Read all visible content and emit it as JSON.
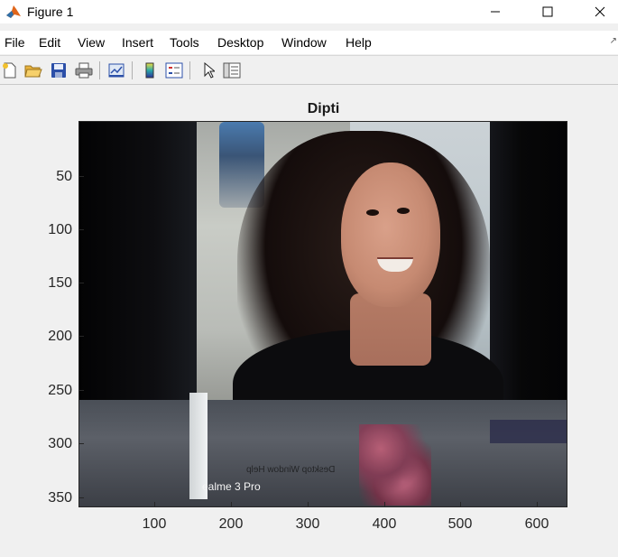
{
  "window": {
    "title": "Figure 1",
    "controls": {
      "minimize": "–",
      "maximize": "☐",
      "close": "✕"
    }
  },
  "menubar": {
    "items": [
      "File",
      "Edit",
      "View",
      "Insert",
      "Tools",
      "Desktop",
      "Window",
      "Help"
    ],
    "overflow_glyph": "↗"
  },
  "toolbar": {
    "buttons": [
      "new-figure-icon",
      "open-file-icon",
      "save-icon",
      "print-icon",
      "link-plot-icon",
      "insert-colorbar-icon",
      "insert-legend-icon",
      "edit-plot-arrow-icon",
      "property-editor-icon"
    ]
  },
  "axes": {
    "title": "Dipti",
    "yticks": [
      "50",
      "100",
      "150",
      "200",
      "250",
      "300",
      "350"
    ],
    "xticks": [
      "100",
      "200",
      "300",
      "400",
      "500",
      "600"
    ]
  },
  "image": {
    "description_text": "",
    "visible_text": {
      "watermark": "ealme 3 Pro",
      "laptop_menu": "Desktop  Window  Help"
    }
  },
  "colors": {
    "window_bg": "#f0f0f0",
    "titlebar_bg": "#ffffff",
    "axes_border": "#262626",
    "matlab_icon_orange": "#e0661b"
  }
}
